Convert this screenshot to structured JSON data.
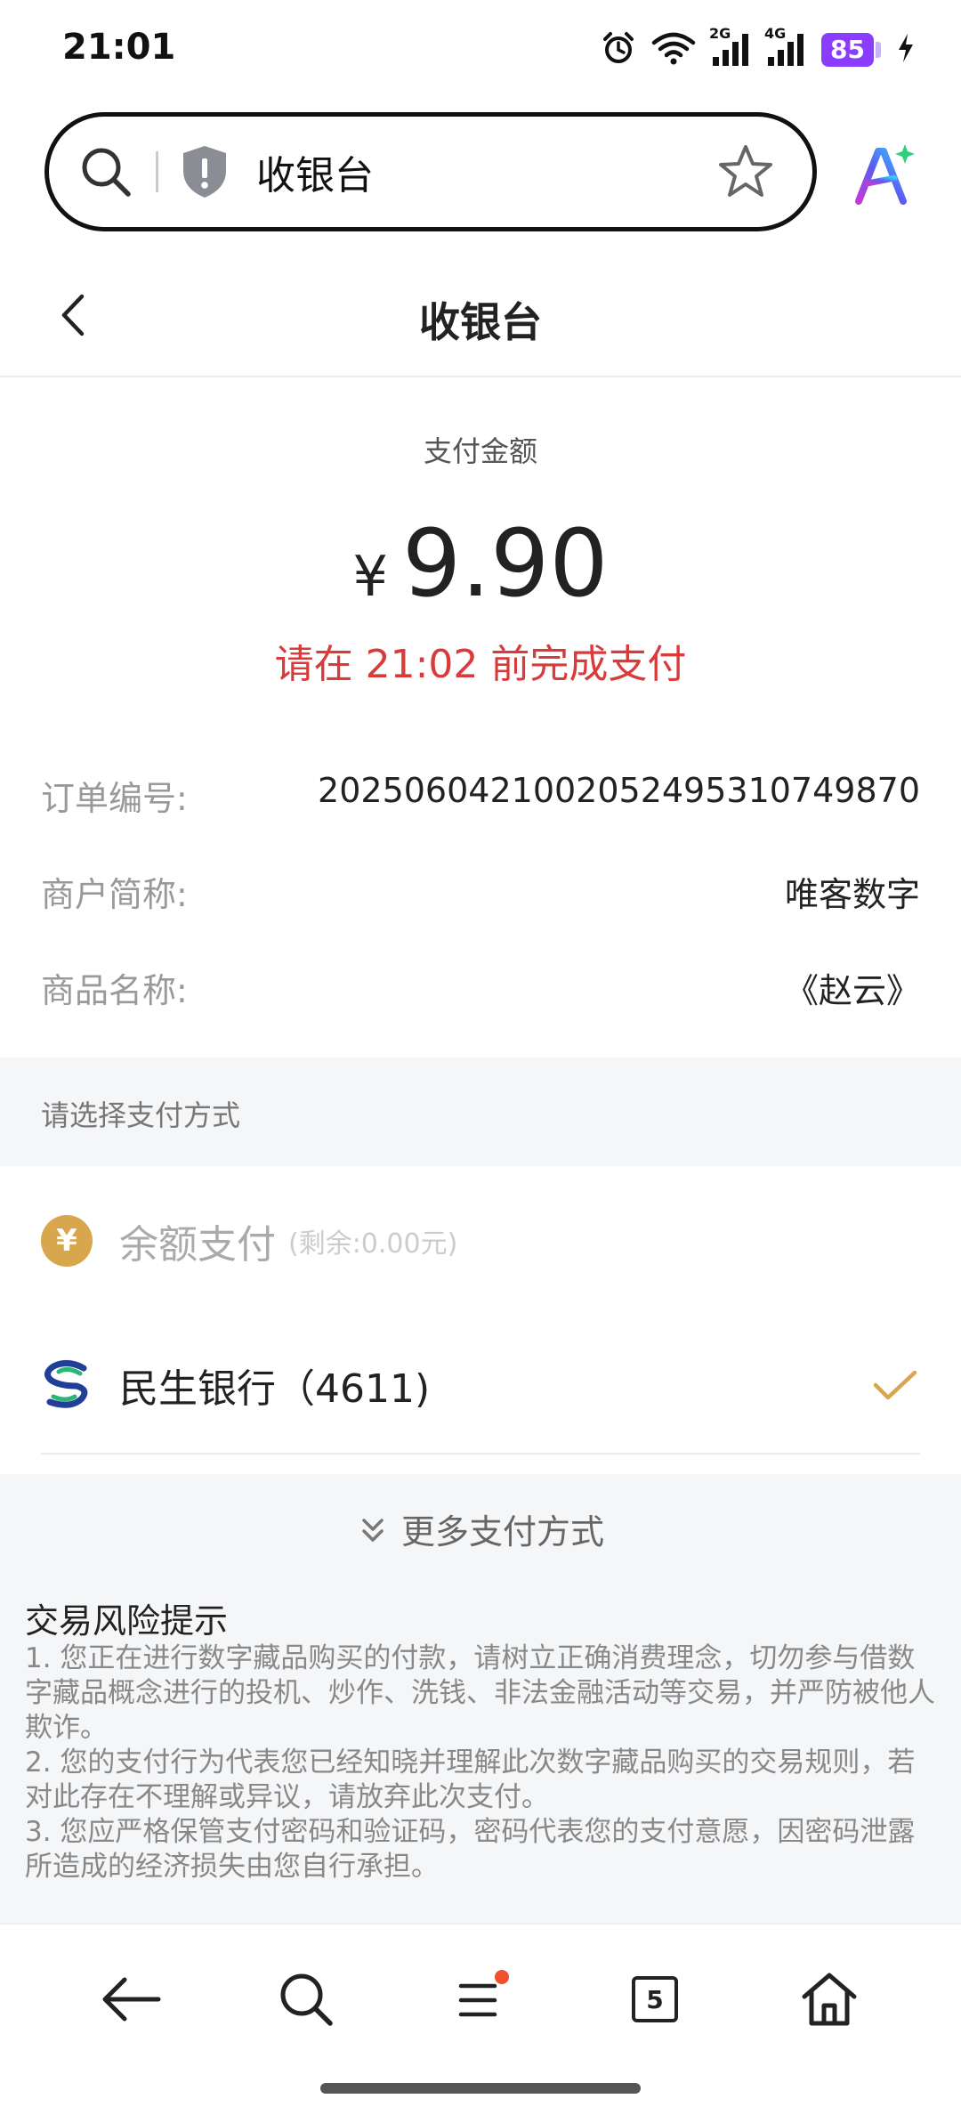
{
  "status_bar": {
    "time": "21:01",
    "signal_1_label": "2G",
    "signal_2_label": "4G",
    "battery": "85"
  },
  "browser": {
    "address_title": "收银台",
    "tab_count": "5"
  },
  "header": {
    "title": "收银台"
  },
  "payment": {
    "amount_label": "支付金额",
    "currency_symbol": "¥",
    "amount": "9.90",
    "deadline": "请在 21:02 前完成支付"
  },
  "order": {
    "rows": [
      {
        "label": "订单编号:",
        "value": "2025060421002052495310749870"
      },
      {
        "label": "商户简称:",
        "value": "唯客数字"
      },
      {
        "label": "商品名称:",
        "value": "《赵云》"
      }
    ]
  },
  "pay_methods": {
    "section_title": "请选择支付方式",
    "balance": {
      "icon_glyph": "¥",
      "label": "余额支付",
      "note": "(剩余:0.00元)"
    },
    "bank": {
      "label": "民生银行（4611)"
    },
    "more_label": "更多支付方式"
  },
  "risk": {
    "title": "交易风险提示",
    "items": [
      "1. 您正在进行数字藏品购买的付款，请树立正确消费理念，切勿参与借数字藏品概念进行的投机、炒作、洗钱、非法金融活动等交易，并严防被他人欺诈。",
      "2. 您的支付行为代表您已经知晓并理解此次数字藏品购买的交易规则，若对此存在不理解或异议，请放弃此次支付。",
      "3. 您应严格保管支付密码和验证码，密码代表您的支付意愿，因密码泄露所造成的经济损失由您自行承担。"
    ]
  },
  "colors": {
    "accent_red": "#d93a3a",
    "check_gold": "#d8a64c",
    "battery_purple": "#8b3dff"
  }
}
